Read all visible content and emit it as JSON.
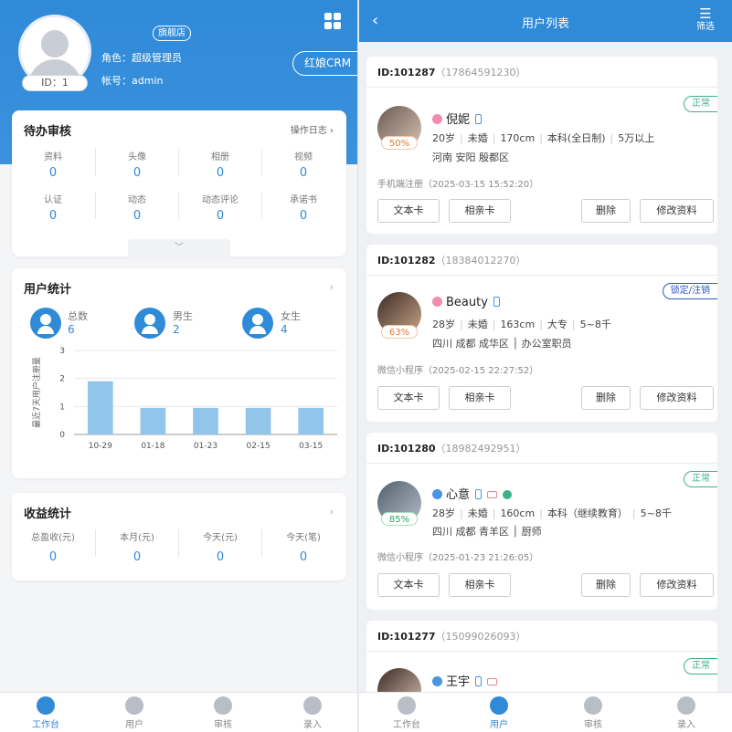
{
  "left": {
    "shop_tag": "旗舰店",
    "user_id": "ID：1",
    "role": "角色：超级管理员",
    "account": "帐号：admin",
    "crm_button": "红娘CRM",
    "pending": {
      "title": "待办审核",
      "link": "操作日志",
      "row1": [
        {
          "label": "资料",
          "value": "0"
        },
        {
          "label": "头像",
          "value": "0"
        },
        {
          "label": "相册",
          "value": "0"
        },
        {
          "label": "视频",
          "value": "0"
        }
      ],
      "row2": [
        {
          "label": "认证",
          "value": "0"
        },
        {
          "label": "动态",
          "value": "0"
        },
        {
          "label": "动态评论",
          "value": "0"
        },
        {
          "label": "承诺书",
          "value": "0"
        }
      ]
    },
    "user_stats": {
      "title": "用户统计",
      "items": [
        {
          "label": "总数",
          "value": "6"
        },
        {
          "label": "男生",
          "value": "2"
        },
        {
          "label": "女生",
          "value": "4"
        }
      ]
    },
    "chart_data": {
      "type": "bar",
      "categories": [
        "10-29",
        "01-18",
        "01-23",
        "02-15",
        "03-15"
      ],
      "values": [
        1.9,
        0.95,
        0.95,
        0.95,
        0.95
      ],
      "ylabel": "最近7天用户注册量",
      "ylim": [
        0,
        3
      ],
      "yticks": [
        "0",
        "1",
        "2",
        "3"
      ],
      "grid": true,
      "bar_color": "#92c5ea"
    },
    "income": {
      "title": "收益统计",
      "items": [
        {
          "label": "总盈收(元)",
          "value": "0"
        },
        {
          "label": "本月(元)",
          "value": "0"
        },
        {
          "label": "今天(元)",
          "value": "0"
        },
        {
          "label": "今天(笔)",
          "value": "0"
        }
      ]
    },
    "tabs": [
      {
        "label": "工作台",
        "active": true
      },
      {
        "label": "用户",
        "active": false
      },
      {
        "label": "审核",
        "active": false
      },
      {
        "label": "录入",
        "active": false
      }
    ]
  },
  "right": {
    "title": "用户列表",
    "filter_label": "筛选",
    "users": [
      {
        "id": "ID:101287",
        "phone": "（17864591230）",
        "status": "正常",
        "pct": "50%",
        "name": "倪妮",
        "info1": [
          "20岁",
          "未婚",
          "170cm",
          "本科(全日制)",
          "5万以上"
        ],
        "info2": "河南 安阳 殷都区",
        "reg": "手机端注册（2025-03-15 15:52:20）"
      },
      {
        "id": "ID:101282",
        "phone": "（18384012270）",
        "status": "锁定/注销",
        "pct": "63%",
        "name": "Beauty",
        "info1": [
          "28岁",
          "未婚",
          "163cm",
          "大专",
          "5~8千"
        ],
        "info2": "四川 成都 成华区 │ 办公室职员",
        "reg": "微信小程序（2025-02-15 22:27:52）"
      },
      {
        "id": "ID:101280",
        "phone": "（18982492951）",
        "status": "正常",
        "pct": "85%",
        "name": "心意",
        "info1": [
          "28岁",
          "未婚",
          "160cm",
          "本科（继续教育）",
          "5~8千"
        ],
        "info2": "四川 成都 青羊区 │ 厨师",
        "reg": "微信小程序（2025-01-23 21:26:05）"
      },
      {
        "id": "ID:101277",
        "phone": "（15099026093）",
        "status": "正常",
        "name": "王宇"
      }
    ],
    "buttons": {
      "text_card": "文本卡",
      "photo_card": "相亲卡",
      "delete": "删除",
      "edit": "修改资料"
    },
    "tabs": [
      {
        "label": "工作台",
        "active": false
      },
      {
        "label": "用户",
        "active": true
      },
      {
        "label": "审核",
        "active": false
      },
      {
        "label": "录入",
        "active": false
      }
    ]
  }
}
